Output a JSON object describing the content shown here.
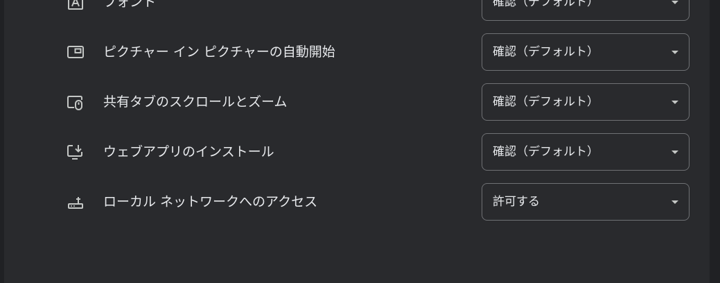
{
  "settings": [
    {
      "icon": "font-icon",
      "label": "フォント",
      "value": "確認（デフォルト）"
    },
    {
      "icon": "picture-in-picture-icon",
      "label": "ピクチャー イン ピクチャーの自動開始",
      "value": "確認（デフォルト）"
    },
    {
      "icon": "shared-tab-scroll-icon",
      "label": "共有タブのスクロールとズーム",
      "value": "確認（デフォルト）"
    },
    {
      "icon": "install-app-icon",
      "label": "ウェブアプリのインストール",
      "value": "確認（デフォルト）"
    },
    {
      "icon": "router-icon",
      "label": "ローカル ネットワークへのアクセス",
      "value": "許可する"
    }
  ],
  "colors": {
    "background": "#202124",
    "panel": "#292a2d",
    "text": "#e8eaed",
    "border": "#6f7174",
    "icon": "#c4c7c5"
  }
}
